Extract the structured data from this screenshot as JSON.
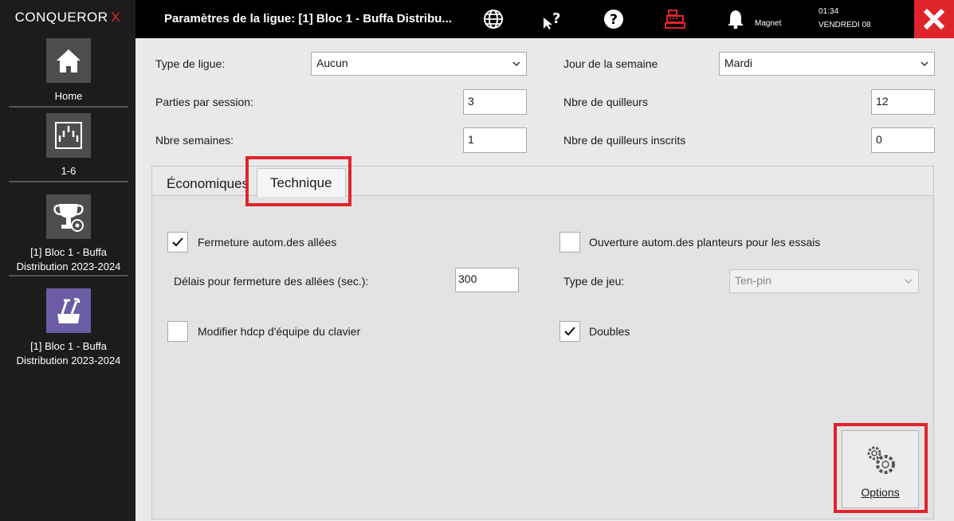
{
  "app": {
    "brand": "CONQUEROR",
    "brand_accent": "X"
  },
  "sidebar": {
    "items": [
      {
        "label": "Home",
        "icon": "home-icon"
      },
      {
        "label": "1-6",
        "icon": "lanes-icon"
      },
      {
        "label": "[1] Bloc 1 - Buffa Distribution 2023-2024",
        "icon": "trophy-gear-icon"
      },
      {
        "label": "[1] Bloc 1 - Buffa Distribution 2023-2024",
        "icon": "tools-box-icon"
      }
    ]
  },
  "topbar": {
    "title": "Paramètres de la ligue: [1] Bloc 1 - Buffa Distribu...",
    "icons": [
      "globe-icon",
      "pointer-help-icon",
      "help-icon",
      "cash-register-icon",
      "bell-icon"
    ],
    "magnet": "Magnet",
    "time": "01:34",
    "date": "VENDREDI 08"
  },
  "form": {
    "type_ligue": {
      "label": "Type de ligue:",
      "value": "Aucun"
    },
    "jour_semaine": {
      "label": "Jour de la semaine",
      "value": "Mardi"
    },
    "parties_session": {
      "label": "Parties par session:",
      "value": "3"
    },
    "nbre_quilleurs": {
      "label": "Nbre de quilleurs",
      "value": "12"
    },
    "nbre_semaines": {
      "label": "Nbre semaines:",
      "value": "1"
    },
    "nbre_inscrits": {
      "label": "Nbre de quilleurs inscrits",
      "value": "0"
    }
  },
  "tabs": [
    {
      "label": "Économiques",
      "active": false
    },
    {
      "label": "Technique",
      "active": true
    }
  ],
  "technique": {
    "fermeture": {
      "label": "Fermeture autom.des allées",
      "checked": true
    },
    "ouverture": {
      "label": "Ouverture autom.des planteurs pour les essais",
      "checked": false
    },
    "delais": {
      "label": "Délais pour fermeture des allées (sec.):",
      "value": "300"
    },
    "type_jeu": {
      "label": "Type de jeu:",
      "value": "Ten-pin"
    },
    "modifier_hdcp": {
      "label": "Modifier hdcp d'équipe du clavier",
      "checked": false
    },
    "doubles": {
      "label": "Doubles",
      "checked": true
    }
  },
  "options_button": {
    "label": "Options",
    "icon": "gears-icon"
  },
  "colors": {
    "accent_red": "#e0242c",
    "sidebar_bg": "#1c1c1c",
    "topbar_bg": "#000000",
    "tile_purple": "#6b5ca5"
  }
}
